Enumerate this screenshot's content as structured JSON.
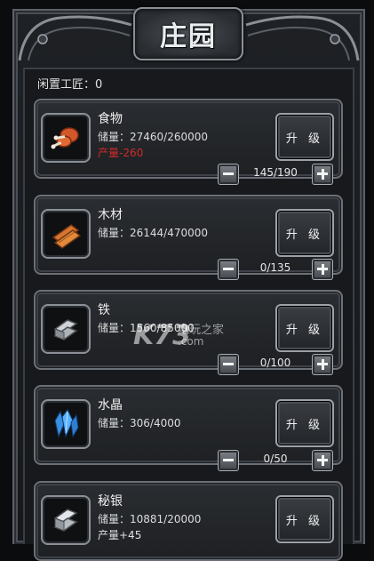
{
  "header": {
    "title": "庄园"
  },
  "idle_workers": "闲置工匠：0",
  "upgrade_label": "升 级",
  "resources": [
    {
      "name": "食物",
      "stock": "储量：27460/260000",
      "output": "产量-260",
      "workers": "145/190",
      "icon": "meat-icon"
    },
    {
      "name": "木材",
      "stock": "储量：26144/470000",
      "output": "",
      "workers": "0/135",
      "icon": "wood-plank-icon"
    },
    {
      "name": "铁",
      "stock": "储量：1560/85000",
      "output": "",
      "workers": "0/100",
      "icon": "iron-ingot-icon"
    },
    {
      "name": "水晶",
      "stock": "储量：306/4000",
      "output": "",
      "workers": "0/50",
      "icon": "crystal-icon"
    },
    {
      "name": "秘银",
      "stock": "储量：10881/20000",
      "output": "产量+45",
      "workers": "",
      "icon": "mithril-ingot-icon"
    }
  ],
  "watermark": {
    "logo": "K73",
    "line1": "电玩之家",
    "line2": ".com"
  },
  "colors": {
    "negative_output": "#d22a2a",
    "frame": "#6c7178",
    "panel_bg": "#17191c"
  }
}
